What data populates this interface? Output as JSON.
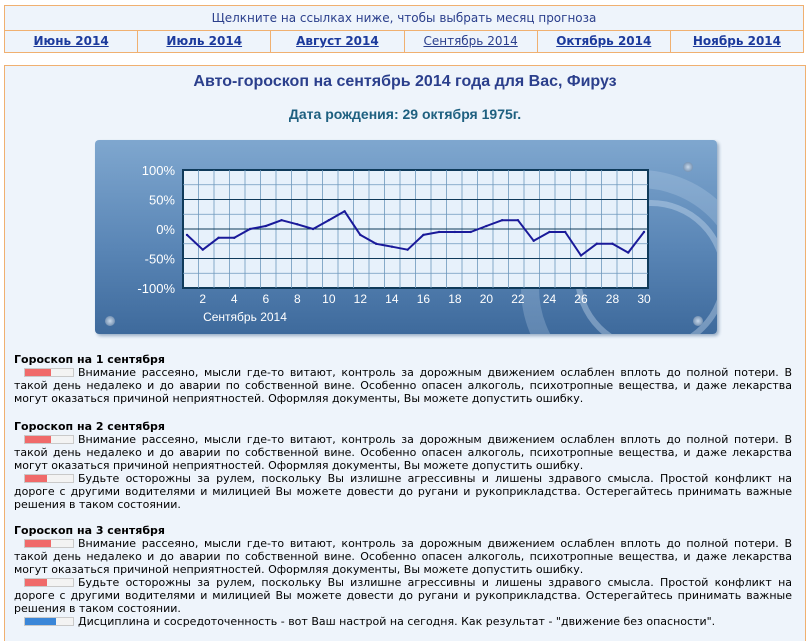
{
  "nav": {
    "title": "Щелкните на ссылках ниже, чтобы выбрать месяц прогноза",
    "months": [
      {
        "label": "Июнь 2014",
        "active": false
      },
      {
        "label": "Июль 2014",
        "active": false
      },
      {
        "label": "Август 2014",
        "active": false
      },
      {
        "label": "Сентябрь 2014",
        "active": true
      },
      {
        "label": "Октябрь 2014",
        "active": false
      },
      {
        "label": "Ноябрь 2014",
        "active": false
      }
    ]
  },
  "main": {
    "title": "Авто-гороскоп на сентябрь 2014 года для Вас, Фируз",
    "birth": "Дата рождения: 29 октября 1975г."
  },
  "chart_data": {
    "type": "line",
    "xlabel": "Сентябрь 2014",
    "ylabel": "",
    "title": "",
    "x": [
      1,
      2,
      3,
      4,
      5,
      6,
      7,
      8,
      9,
      10,
      11,
      12,
      13,
      14,
      15,
      16,
      17,
      18,
      19,
      20,
      21,
      22,
      23,
      24,
      25,
      26,
      27,
      28,
      29,
      30
    ],
    "values": [
      -10,
      -35,
      -15,
      -15,
      0,
      5,
      15,
      8,
      0,
      15,
      30,
      -10,
      -25,
      -30,
      -35,
      -10,
      -5,
      -5,
      -5,
      5,
      15,
      15,
      -20,
      -5,
      -5,
      -45,
      -25,
      -25,
      -40,
      -5
    ],
    "ylim": [
      -100,
      100
    ],
    "yticks": [
      "100%",
      "50%",
      "0%",
      "-50%",
      "-100%"
    ],
    "xticks": [
      "2",
      "4",
      "6",
      "8",
      "10",
      "12",
      "14",
      "16",
      "18",
      "20",
      "22",
      "24",
      "26",
      "28",
      "30"
    ],
    "grid": true,
    "line_color": "#1a1a9a"
  },
  "sections": [
    {
      "heading": "Гороскоп на 1 сентября",
      "items": [
        {
          "level": 0.55,
          "color": "red",
          "text": "Внимание рассеяно, мысли где-то витают, контроль за дорожным движением ослаблен вплоть до полной потери. В такой день недалеко и до аварии по собственной вине. Особенно опасен алкоголь, психотропные вещества, и даже лекарства могут оказаться причиной неприятностей. Оформляя документы, Вы можете допустить ошибку."
        }
      ]
    },
    {
      "heading": "Гороскоп на 2 сентября",
      "items": [
        {
          "level": 0.55,
          "color": "red",
          "text": "Внимание рассеяно, мысли где-то витают, контроль за дорожным движением ослаблен вплоть до полной потери. В такой день недалеко и до аварии по собственной вине. Особенно опасен алкоголь, психотропные вещества, и даже лекарства могут оказаться причиной неприятностей. Оформляя документы, Вы можете допустить ошибку."
        },
        {
          "level": 0.45,
          "color": "red",
          "text": "Будьте осторожны за рулем, поскольку Вы излишне агрессивны и лишены здравого смысла. Простой конфликт на дороге с другими водителями и милицией Вы можете довести до ругани и рукоприкладства. Остерегайтесь принимать важные решения в таком состоянии."
        }
      ]
    },
    {
      "heading": "Гороскоп на 3 сентября",
      "items": [
        {
          "level": 0.55,
          "color": "red",
          "text": "Внимание рассеяно, мысли где-то витают, контроль за дорожным движением ослаблен вплоть до полной потери. В такой день недалеко и до аварии по собственной вине. Особенно опасен алкоголь, психотропные вещества, и даже лекарства могут оказаться причиной неприятностей. Оформляя документы, Вы можете допустить ошибку."
        },
        {
          "level": 0.45,
          "color": "red",
          "text": "Будьте осторожны за рулем, поскольку Вы излишне агрессивны и лишены здравого смысла. Простой конфликт на дороге с другими водителями и милицией Вы можете довести до ругани и рукоприкладства. Остерегайтесь принимать важные решения в таком состоянии."
        },
        {
          "level": 0.65,
          "color": "blue",
          "text": "Дисциплина и сосредоточенность - вот Ваш настрой на сегодня. Как результат - \"движение без опасности\"."
        }
      ]
    }
  ]
}
